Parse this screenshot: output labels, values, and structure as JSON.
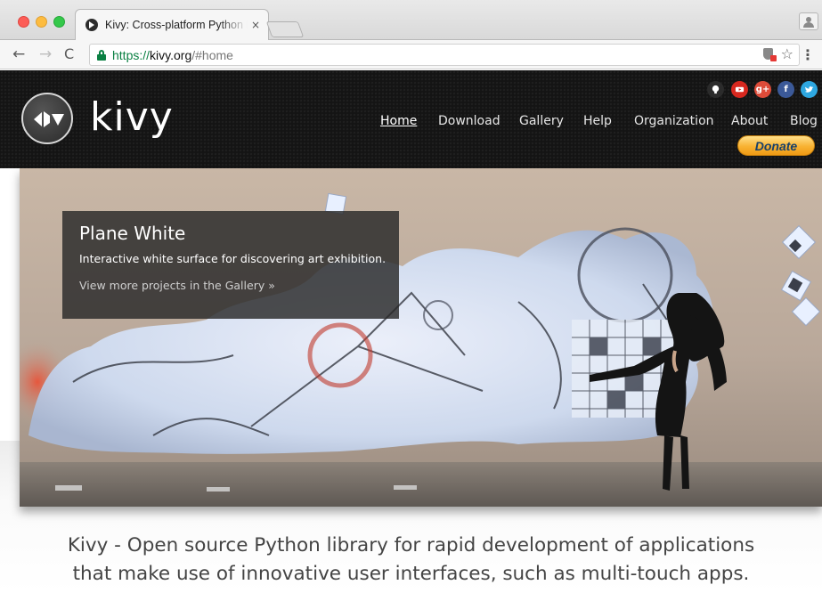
{
  "browser": {
    "tab_title": "Kivy: Cross-platform Python Fr",
    "tab_close": "×",
    "url": {
      "scheme": "https://",
      "host": "kivy.org",
      "path": "/#home"
    },
    "back": "←",
    "forward": "→",
    "reload": "C",
    "bookmark": "☆",
    "menu": "⋮"
  },
  "site": {
    "logo_text": "kivy",
    "nav": [
      {
        "label": "Home",
        "active": true
      },
      {
        "label": "Download"
      },
      {
        "label": "Gallery"
      },
      {
        "label": "Help"
      },
      {
        "label": "Organization"
      },
      {
        "label": "About"
      },
      {
        "label": "Blog"
      }
    ],
    "social": [
      {
        "name": "github-icon",
        "glyph": "",
        "color": "#2b2b2b"
      },
      {
        "name": "youtube-icon",
        "glyph": "",
        "color": "#d7281f"
      },
      {
        "name": "google-plus-icon",
        "glyph": "g+",
        "color": "#dd4b39"
      },
      {
        "name": "facebook-icon",
        "glyph": "f",
        "color": "#3b5998"
      },
      {
        "name": "twitter-icon",
        "glyph": "",
        "color": "#2ea7e0"
      }
    ],
    "donate_label": "Donate"
  },
  "hero": {
    "title": "Plane White",
    "description": "Interactive white surface for discovering art exhibition.",
    "link": "View more projects in the Gallery »"
  },
  "tagline": {
    "line1": "Kivy - Open source Python library for rapid development of applications",
    "line2": "that make use of innovative user interfaces, such as multi-touch apps."
  }
}
